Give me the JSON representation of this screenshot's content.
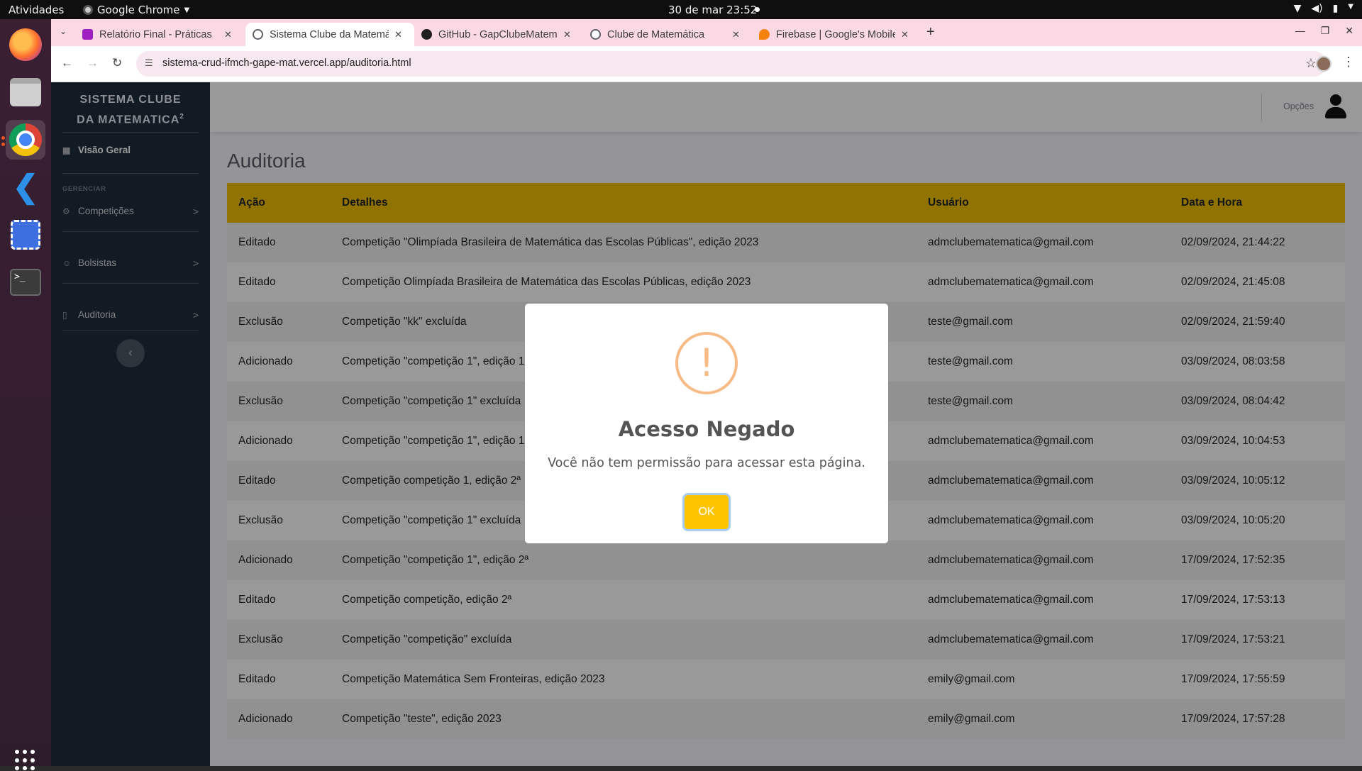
{
  "system": {
    "activities": "Atividades",
    "app_name": "Google Chrome",
    "clock": "30 de mar  23:52"
  },
  "browser": {
    "tabs": [
      {
        "title": "Relatório Final - Práticas",
        "favicon_color": "#a01fbf"
      },
      {
        "title": "Sistema Clube da Matemática",
        "favicon_color": "#5f6368"
      },
      {
        "title": "GitHub - GapClubeMatemática",
        "favicon_color": "#1f1f1f"
      },
      {
        "title": "Clube de Matemática",
        "favicon_color": "#5f6368"
      },
      {
        "title": "Firebase | Google's Mobile",
        "favicon_color": "#f5820d"
      }
    ],
    "url": "sistema-crud-ifmch-gape-mat.vercel.app/auditoria.html"
  },
  "sidebar": {
    "brand_line1": "SISTEMA CLUBE",
    "brand_line2": "DA MATEMATICA",
    "brand_sup": "2",
    "overview": "Visão Geral",
    "heading": "GERENCIAR",
    "items": [
      {
        "label": "Competições",
        "icon": "gear-icon"
      },
      {
        "label": "Bolsistas",
        "icon": "user-icon"
      },
      {
        "label": "Auditoria",
        "icon": "file-icon"
      }
    ]
  },
  "topnav": {
    "options_label": "Opções"
  },
  "main": {
    "title": "Auditoria",
    "columns": [
      "Ação",
      "Detalhes",
      "Usuário",
      "Data e Hora"
    ],
    "rows": [
      [
        "Editado",
        "Competição \"Olimpíada Brasileira de Matemática das Escolas Públicas\", edição 2023",
        "admclubematematica@gmail.com",
        "02/09/2024, 21:44:22"
      ],
      [
        "Editado",
        "Competição Olimpíada Brasileira de Matemática das Escolas Públicas, edição 2023",
        "admclubematematica@gmail.com",
        "02/09/2024, 21:45:08"
      ],
      [
        "Exclusão",
        "Competição \"kk\" excluída",
        "teste@gmail.com",
        "02/09/2024, 21:59:40"
      ],
      [
        "Adicionado",
        "Competição \"competição 1\", edição 1",
        "teste@gmail.com",
        "03/09/2024, 08:03:58"
      ],
      [
        "Exclusão",
        "Competição \"competição 1\" excluída",
        "teste@gmail.com",
        "03/09/2024, 08:04:42"
      ],
      [
        "Adicionado",
        "Competição \"competição 1\", edição 1",
        "admclubematematica@gmail.com",
        "03/09/2024, 10:04:53"
      ],
      [
        "Editado",
        "Competição competição 1, edição 2ª",
        "admclubematematica@gmail.com",
        "03/09/2024, 10:05:12"
      ],
      [
        "Exclusão",
        "Competição \"competição 1\" excluída",
        "admclubematematica@gmail.com",
        "03/09/2024, 10:05:20"
      ],
      [
        "Adicionado",
        "Competição \"competição 1\", edição 2ª",
        "admclubematematica@gmail.com",
        "17/09/2024, 17:52:35"
      ],
      [
        "Editado",
        "Competição competição, edição 2ª",
        "admclubematematica@gmail.com",
        "17/09/2024, 17:53:13"
      ],
      [
        "Exclusão",
        "Competição \"competição\" excluída",
        "admclubematematica@gmail.com",
        "17/09/2024, 17:53:21"
      ],
      [
        "Editado",
        "Competição Matemática Sem Fronteiras, edição 2023",
        "emily@gmail.com",
        "17/09/2024, 17:55:59"
      ],
      [
        "Adicionado",
        "Competição \"teste\", edição 2023",
        "emily@gmail.com",
        "17/09/2024, 17:57:28"
      ]
    ]
  },
  "modal": {
    "icon": "!",
    "title": "Acesso Negado",
    "message": "Você não tem permissão para acessar esta página.",
    "ok_label": "OK"
  },
  "colors": {
    "table_header": "#f0c000",
    "sidebar": "#1f2d3d",
    "ok_button": "#ffc400",
    "warning_icon": "#f8bb86"
  }
}
